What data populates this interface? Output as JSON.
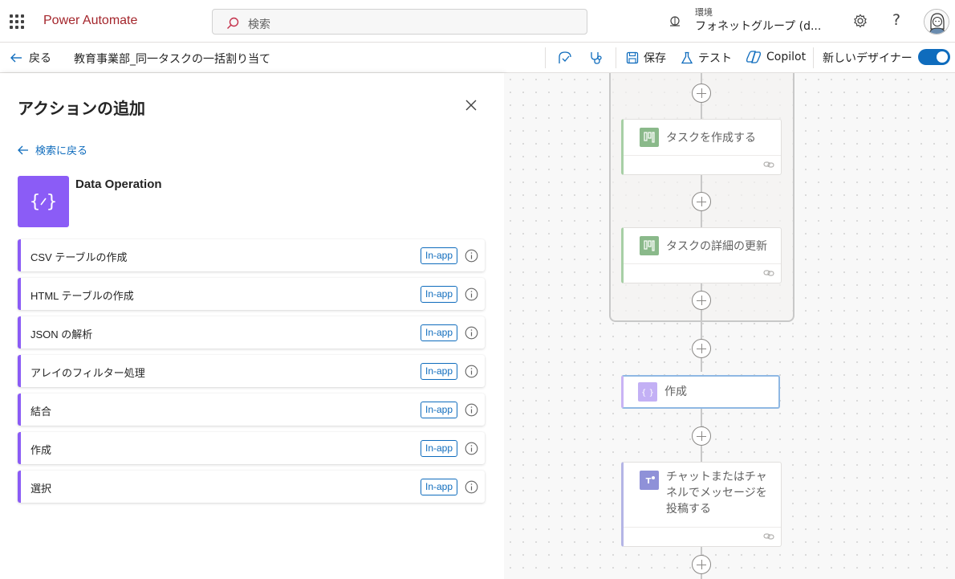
{
  "header": {
    "app_name": "Power Automate",
    "search_placeholder": "検索",
    "environment_label": "環境",
    "environment_name": "フォネットグループ (d..."
  },
  "commandbar": {
    "back_label": "戻る",
    "flow_title": "教育事業部_同一タスクの一括割り当て",
    "save_label": "保存",
    "test_label": "テスト",
    "copilot_label": "Copilot",
    "new_designer_label": "新しいデザイナー",
    "new_designer_on": true
  },
  "panel": {
    "title": "アクションの追加",
    "back_to_search": "検索に戻る",
    "connector_name": "Data Operation",
    "actions": [
      {
        "label": "CSV テーブルの作成",
        "badge": "In-app"
      },
      {
        "label": "HTML テーブルの作成",
        "badge": "In-app"
      },
      {
        "label": "JSON の解析",
        "badge": "In-app"
      },
      {
        "label": "アレイのフィルター処理",
        "badge": "In-app"
      },
      {
        "label": "結合",
        "badge": "In-app"
      },
      {
        "label": "作成",
        "badge": "In-app"
      },
      {
        "label": "選択",
        "badge": "In-app"
      }
    ]
  },
  "canvas": {
    "cards": [
      {
        "title": "タスクを作成する",
        "icon": "planner-icon"
      },
      {
        "title": "タスクの詳細の更新",
        "icon": "planner-icon"
      },
      {
        "title": "作成",
        "icon": "data-operation-icon"
      },
      {
        "title_lines": [
          "チャットまたはチャ",
          "ネルでメッセージを",
          "投稿する"
        ],
        "icon": "teams-icon"
      }
    ]
  },
  "colors": {
    "brand": "#a4262c",
    "accent": "#0f6cbd",
    "data_operation": "#8b5cf6",
    "planner": "#31752f",
    "teams": "#5b5fc7"
  }
}
